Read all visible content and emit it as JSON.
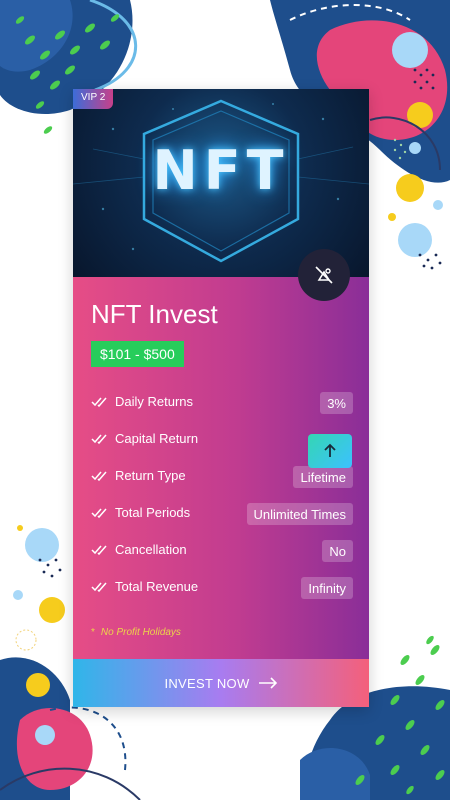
{
  "card": {
    "badge": "VIP 2",
    "hero_text": "NFT",
    "title": "NFT Invest",
    "price_range": "$101 - $500",
    "details": [
      {
        "label": "Daily Returns",
        "value": "3%"
      },
      {
        "label": "Capital Return",
        "value": ""
      },
      {
        "label": "Return Type",
        "value": "Lifetime"
      },
      {
        "label": "Total Periods",
        "value": "Unlimited Times"
      },
      {
        "label": "Cancellation",
        "value": "No"
      },
      {
        "label": "Total Revenue",
        "value": "Infinity"
      }
    ],
    "note": "No Profit Holidays",
    "invest_label": "INVEST NOW"
  },
  "icons": {
    "avatar": "no-image-icon",
    "scroll": "arrow-up-icon",
    "check": "double-check-icon",
    "invest_arrow": "arrow-right-icon"
  },
  "colors": {
    "price_badge": "#27cd5b",
    "note": "#ecd44a",
    "accent_pink": "#e64d86",
    "accent_purple": "#8a2e98"
  }
}
